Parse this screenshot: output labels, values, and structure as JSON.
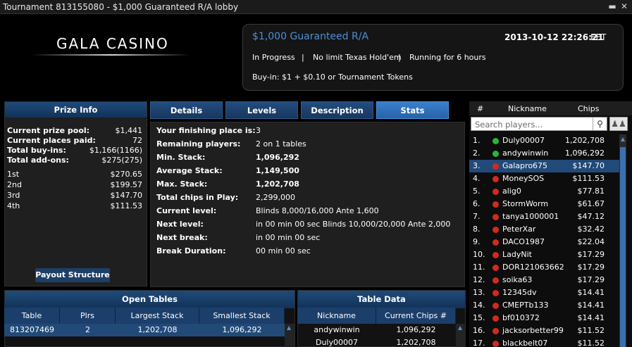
{
  "window": {
    "title": "Tournament 813155080 - $1,000 Guaranteed R/A lobby",
    "minimize": "▬",
    "close": "✕"
  },
  "logo": {
    "text": "GALA CASINO"
  },
  "tournament": {
    "name": "$1,000 Guaranteed R/A",
    "date": "2013-10-12 22:26:21",
    "tz": "EET",
    "status": "In Progress",
    "game": "No limit Texas Hold'em",
    "running": "Running for 6 hours",
    "separator": "|",
    "buyin": "Buy-in: $1 + $0.10 or Tournament Tokens"
  },
  "prize_info": {
    "title": "Prize Info",
    "summary": [
      {
        "label": "Current prize pool:",
        "value": "$1,441"
      },
      {
        "label": "Current places paid:",
        "value": "72"
      },
      {
        "label": "Total buy-ins:",
        "value": "$1,166(1166)"
      },
      {
        "label": "Total add-ons:",
        "value": "$275(275)"
      }
    ],
    "places": [
      {
        "label": "1st",
        "value": "$270.65"
      },
      {
        "label": "2nd",
        "value": "$199.57"
      },
      {
        "label": "3rd",
        "value": "$147.70"
      },
      {
        "label": "4th",
        "value": "$111.53"
      }
    ],
    "payout_button": "Payout Structure"
  },
  "tabs": [
    {
      "label": "Details",
      "active": false
    },
    {
      "label": "Levels",
      "active": false
    },
    {
      "label": "Description",
      "active": false
    },
    {
      "label": "Stats",
      "active": true
    }
  ],
  "stats": [
    {
      "label": "Your finishing place is:",
      "value": "3",
      "bold": false
    },
    {
      "label": "Remaining players:",
      "value": "2 on 1 tables",
      "bold": false
    },
    {
      "label": "Min. Stack:",
      "value": "1,096,292",
      "bold": true
    },
    {
      "label": "Average Stack:",
      "value": "1,149,500",
      "bold": true
    },
    {
      "label": "Max. Stack:",
      "value": "1,202,708",
      "bold": true
    },
    {
      "label": "Total chips in Play:",
      "value": "2,299,000",
      "bold": false
    },
    {
      "label": "Current level:",
      "value": "Blinds 8,000/16,000 Ante 1,600",
      "bold": false
    },
    {
      "label": "Next level:",
      "value": "in 00 min 00 sec  Blinds 10,000/20,000 Ante 2,000",
      "bold": false
    },
    {
      "label": "Next break:",
      "value": "in 00 min 00 sec",
      "bold": false
    },
    {
      "label": "Break Duration:",
      "value": "00 min 00 sec",
      "bold": false
    }
  ],
  "players": {
    "columns": {
      "rank": "#",
      "nickname": "Nickname",
      "chips": "Chips"
    },
    "search_placeholder": "Search players...",
    "search_icon": "search-icon",
    "people_icon": "people-icon",
    "colors": {
      "online": "#2bb33a",
      "offline": "#d22a1f",
      "selected": "#224a78"
    },
    "rows": [
      {
        "rank": "1.",
        "nick": "Duly00007",
        "chips": "1,202,708",
        "status": "online"
      },
      {
        "rank": "2.",
        "nick": "andywinwin",
        "chips": "1,096,292",
        "status": "online"
      },
      {
        "rank": "3.",
        "nick": "Galapro675",
        "chips": "$147.70",
        "status": "offline",
        "selected": true
      },
      {
        "rank": "4.",
        "nick": "MoneySOS",
        "chips": "$111.53",
        "status": "offline"
      },
      {
        "rank": "5.",
        "nick": "alig0",
        "chips": "$77.81",
        "status": "offline"
      },
      {
        "rank": "6.",
        "nick": "StormWorm",
        "chips": "$61.67",
        "status": "offline"
      },
      {
        "rank": "7.",
        "nick": "tanya1000001",
        "chips": "$47.12",
        "status": "offline"
      },
      {
        "rank": "8.",
        "nick": "PeterXar",
        "chips": "$32.42",
        "status": "offline"
      },
      {
        "rank": "9.",
        "nick": "DACO1987",
        "chips": "$22.04",
        "status": "offline"
      },
      {
        "rank": "10.",
        "nick": "LadyNit",
        "chips": "$17.29",
        "status": "offline"
      },
      {
        "rank": "11.",
        "nick": "DOR121063662",
        "chips": "$17.29",
        "status": "offline"
      },
      {
        "rank": "12.",
        "nick": "soika63",
        "chips": "$17.29",
        "status": "offline"
      },
      {
        "rank": "13.",
        "nick": "12345dv",
        "chips": "$14.41",
        "status": "offline"
      },
      {
        "rank": "14.",
        "nick": "CMEPTb133",
        "chips": "$14.41",
        "status": "offline"
      },
      {
        "rank": "15.",
        "nick": "bf010372",
        "chips": "$14.41",
        "status": "offline"
      },
      {
        "rank": "16.",
        "nick": "jacksorbetter99",
        "chips": "$11.52",
        "status": "offline"
      },
      {
        "rank": "17.",
        "nick": "blackbelt07",
        "chips": "$11.52",
        "status": "offline"
      }
    ]
  },
  "open_tables": {
    "title": "Open Tables",
    "columns": [
      "Table",
      "Plrs",
      "Largest Stack",
      "Smallest Stack"
    ],
    "rows": [
      [
        "813207469",
        "2",
        "1,202,708",
        "1,096,292"
      ]
    ]
  },
  "table_data": {
    "title": "Table Data",
    "columns": [
      "Nickname",
      "Current Chips #"
    ],
    "rows": [
      [
        "andywinwin",
        "1,096,292"
      ],
      [
        "Duly00007",
        "1,202,708"
      ]
    ]
  }
}
